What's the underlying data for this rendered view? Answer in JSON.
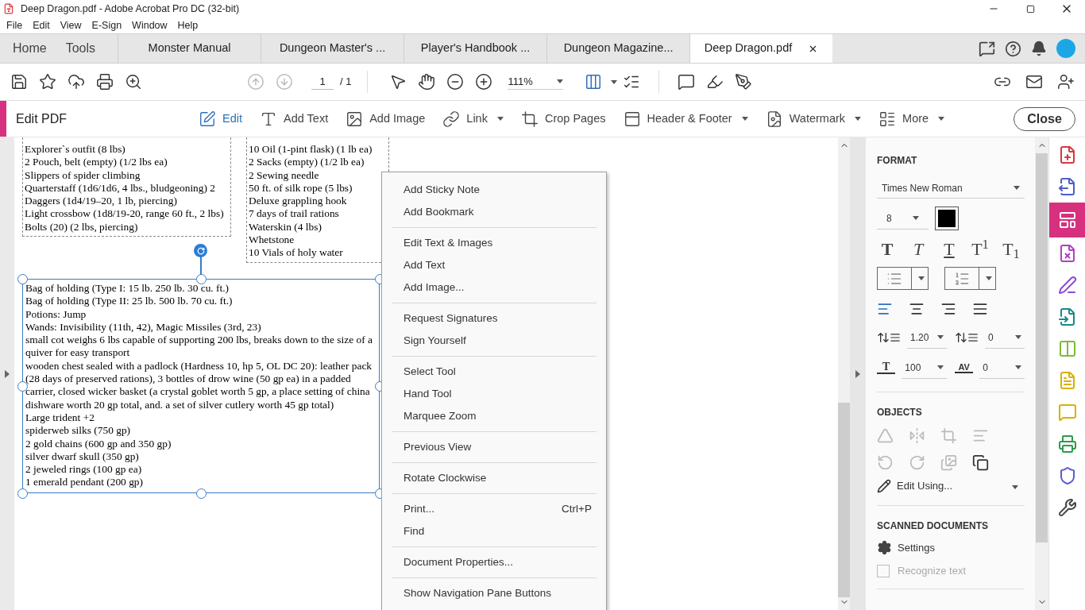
{
  "window": {
    "title": "Deep Dragon.pdf - Adobe Acrobat Pro DC (32-bit)"
  },
  "menu_bar": [
    "File",
    "Edit",
    "View",
    "E-Sign",
    "Window",
    "Help"
  ],
  "nav_tabs": [
    {
      "label": "Home",
      "selected": false
    },
    {
      "label": "Tools",
      "selected": false
    }
  ],
  "document_tabs": [
    {
      "label": "Monster Manual",
      "selected": false
    },
    {
      "label": "Dungeon Master's ...",
      "selected": false
    },
    {
      "label": "Player's Handbook ...",
      "selected": false
    },
    {
      "label": "Dungeon Magazine...",
      "selected": false
    },
    {
      "label": "Deep Dragon.pdf",
      "selected": true
    }
  ],
  "toolbar": {
    "page_nav": [
      {
        "kind": "previous",
        "disabled": true
      },
      {
        "kind": "next",
        "disabled": true
      }
    ],
    "page": "1",
    "page_count": "/ 1",
    "zoom": "111%"
  },
  "edit_bar": {
    "title": "Edit PDF",
    "tools": [
      {
        "kind": "edit",
        "label": "Edit",
        "selected": true,
        "dropdown": false
      },
      {
        "kind": "text",
        "label": "Add Text",
        "selected": false,
        "dropdown": false
      },
      {
        "kind": "image",
        "label": "Add Image",
        "selected": false,
        "dropdown": false
      },
      {
        "kind": "link",
        "label": "Link",
        "selected": false,
        "dropdown": true
      },
      {
        "kind": "crop",
        "label": "Crop Pages",
        "selected": false,
        "dropdown": false
      },
      {
        "kind": "header",
        "label": "Header & Footer",
        "selected": false,
        "dropdown": true
      },
      {
        "kind": "watermark",
        "label": "Watermark",
        "selected": false,
        "dropdown": true
      },
      {
        "kind": "more",
        "label": "More",
        "selected": false,
        "dropdown": true
      }
    ],
    "close": "Close"
  },
  "page": {
    "text_boxes": [
      {
        "selected": false,
        "lines": [
          "Explorer`s outfit (8 lbs)",
          "2 Pouch, belt (empty) (1/2 lbs ea)",
          "Slippers of spider climbing",
          "Quarterstaff (1d6/1d6, 4 lbs., bludgeoning) 2",
          "Daggers (1d4/19–20, 1 lb, piercing)",
          "Light crossbow (1d8/19-20, range 60 ft., 2 lbs)",
          "Bolts (20) (2 lbs, piercing)"
        ]
      },
      {
        "selected": false,
        "lines": [
          "10 Oil (1-pint flask) (1 lb ea)",
          "2 Sacks (empty) (1/2 lb ea)",
          "2 Sewing needle",
          "50 ft. of silk rope (5 lbs)",
          "Deluxe grappling hook",
          "7 days of trail rations",
          "Waterskin (4 lbs)",
          "Whetstone",
          "10 Vials of holy water"
        ]
      },
      {
        "selected": true,
        "lines": [
          "Bag of holding (Type I: 15 lb. 250 lb. 30 cu. ft.)",
          "Bag of holding (Type II: 25 lb. 500 lb. 70 cu. ft.)",
          "Potions: Jump",
          "Wands: Invisibility (11th, 42), Magic Missiles (3rd, 23)",
          "small cot weighs 6 lbs capable of supporting 200 lbs, breaks down to the size of a quiver for easy transport",
          "wooden chest sealed with a padlock (Hardness 10, hp 5, OL DC 20): leather pack (28 days of preserved rations), 3 bottles of drow wine (50 gp ea) in a padded carrier, closed wicker basket (a crystal goblet worth 5 gp, a place setting of china dishware worth 20 gp total, and. a set of silver cutlery worth 45 gp total)",
          "Large trident +2",
          "spiderweb silks (750 gp)",
          "2 gold chains (600 gp and 350 gp)",
          "silver dwarf skull (350 gp)",
          "2 jeweled rings (100 gp ea)",
          "1 emerald pendant (200 gp)"
        ]
      }
    ]
  },
  "context_menu": [
    [
      {
        "label": "Add Sticky Note"
      },
      {
        "label": "Add Bookmark"
      }
    ],
    [
      {
        "label": "Edit Text & Images"
      },
      {
        "label": "Add Text"
      },
      {
        "label": "Add Image..."
      }
    ],
    [
      {
        "label": "Request Signatures"
      },
      {
        "label": "Sign Yourself"
      }
    ],
    [
      {
        "label": "Select Tool"
      },
      {
        "label": "Hand Tool"
      },
      {
        "label": "Marquee Zoom"
      }
    ],
    [
      {
        "label": "Previous View"
      }
    ],
    [
      {
        "label": "Rotate Clockwise"
      }
    ],
    [
      {
        "label": "Print...",
        "shortcut": "Ctrl+P"
      },
      {
        "label": "Find"
      }
    ],
    [
      {
        "label": "Document Properties..."
      }
    ],
    [
      {
        "label": "Show Navigation Pane Buttons"
      }
    ]
  ],
  "format_panel": {
    "heading": "FORMAT",
    "font": "Times New Roman",
    "size": "8",
    "text_styles": [
      {
        "kind": "bold",
        "label": "T"
      },
      {
        "kind": "italic",
        "label": "T"
      },
      {
        "kind": "underline",
        "label": "T"
      },
      {
        "kind": "superscript",
        "label": "T$^{1}$"
      },
      {
        "kind": "subscript",
        "label": "T$_{1}$"
      }
    ],
    "alignments": [
      {
        "kind": "left",
        "selected": true
      },
      {
        "kind": "center",
        "selected": false
      },
      {
        "kind": "right",
        "selected": false
      },
      {
        "kind": "justify",
        "selected": false
      }
    ],
    "spacing": [
      {
        "kind": "line",
        "value": "1.20"
      },
      {
        "kind": "paragraph",
        "value": "0"
      },
      {
        "kind": "scale",
        "icon_text": "T",
        "value": "100"
      },
      {
        "kind": "tracking",
        "icon_text": "AV",
        "value": "0"
      }
    ],
    "objects_heading": "OBJECTS",
    "objects": [
      {
        "kind": "flip-horizontal",
        "disabled": true
      },
      {
        "kind": "flip-vertical",
        "disabled": true
      },
      {
        "kind": "crop",
        "disabled": true
      },
      {
        "kind": "align",
        "disabled": true
      },
      {
        "kind": "rotate-left",
        "disabled": true
      },
      {
        "kind": "rotate-right",
        "disabled": true
      },
      {
        "kind": "replace-image",
        "disabled": true
      },
      {
        "kind": "arrange",
        "disabled": false
      }
    ],
    "edit_using": "Edit Using...",
    "scanned_heading": "SCANNED DOCUMENTS",
    "settings": "Settings",
    "recognize": {
      "label": "Recognize text",
      "checked": false,
      "disabled": true
    }
  },
  "tool_rail": [
    {
      "kind": "create",
      "color": "#d9373e",
      "selected": false
    },
    {
      "kind": "export",
      "color": "#4b5ec9",
      "selected": false
    },
    {
      "kind": "edit",
      "color": "#d6307f",
      "selected": true
    },
    {
      "kind": "organize",
      "color": "#b23fc4",
      "selected": false
    },
    {
      "kind": "sign",
      "color": "#8a4bd6",
      "selected": false
    },
    {
      "kind": "send",
      "color": "#178a8a",
      "selected": false
    },
    {
      "kind": "compare",
      "color": "#7dbb3a",
      "selected": false
    },
    {
      "kind": "review",
      "color": "#d9b100",
      "selected": false
    },
    {
      "kind": "comment",
      "color": "#d9b100",
      "selected": false
    },
    {
      "kind": "print",
      "color": "#2e9a4a",
      "selected": false
    },
    {
      "kind": "protect",
      "color": "#5a5ad6",
      "selected": false
    },
    {
      "kind": "tools",
      "color": "#444444",
      "selected": false
    }
  ]
}
